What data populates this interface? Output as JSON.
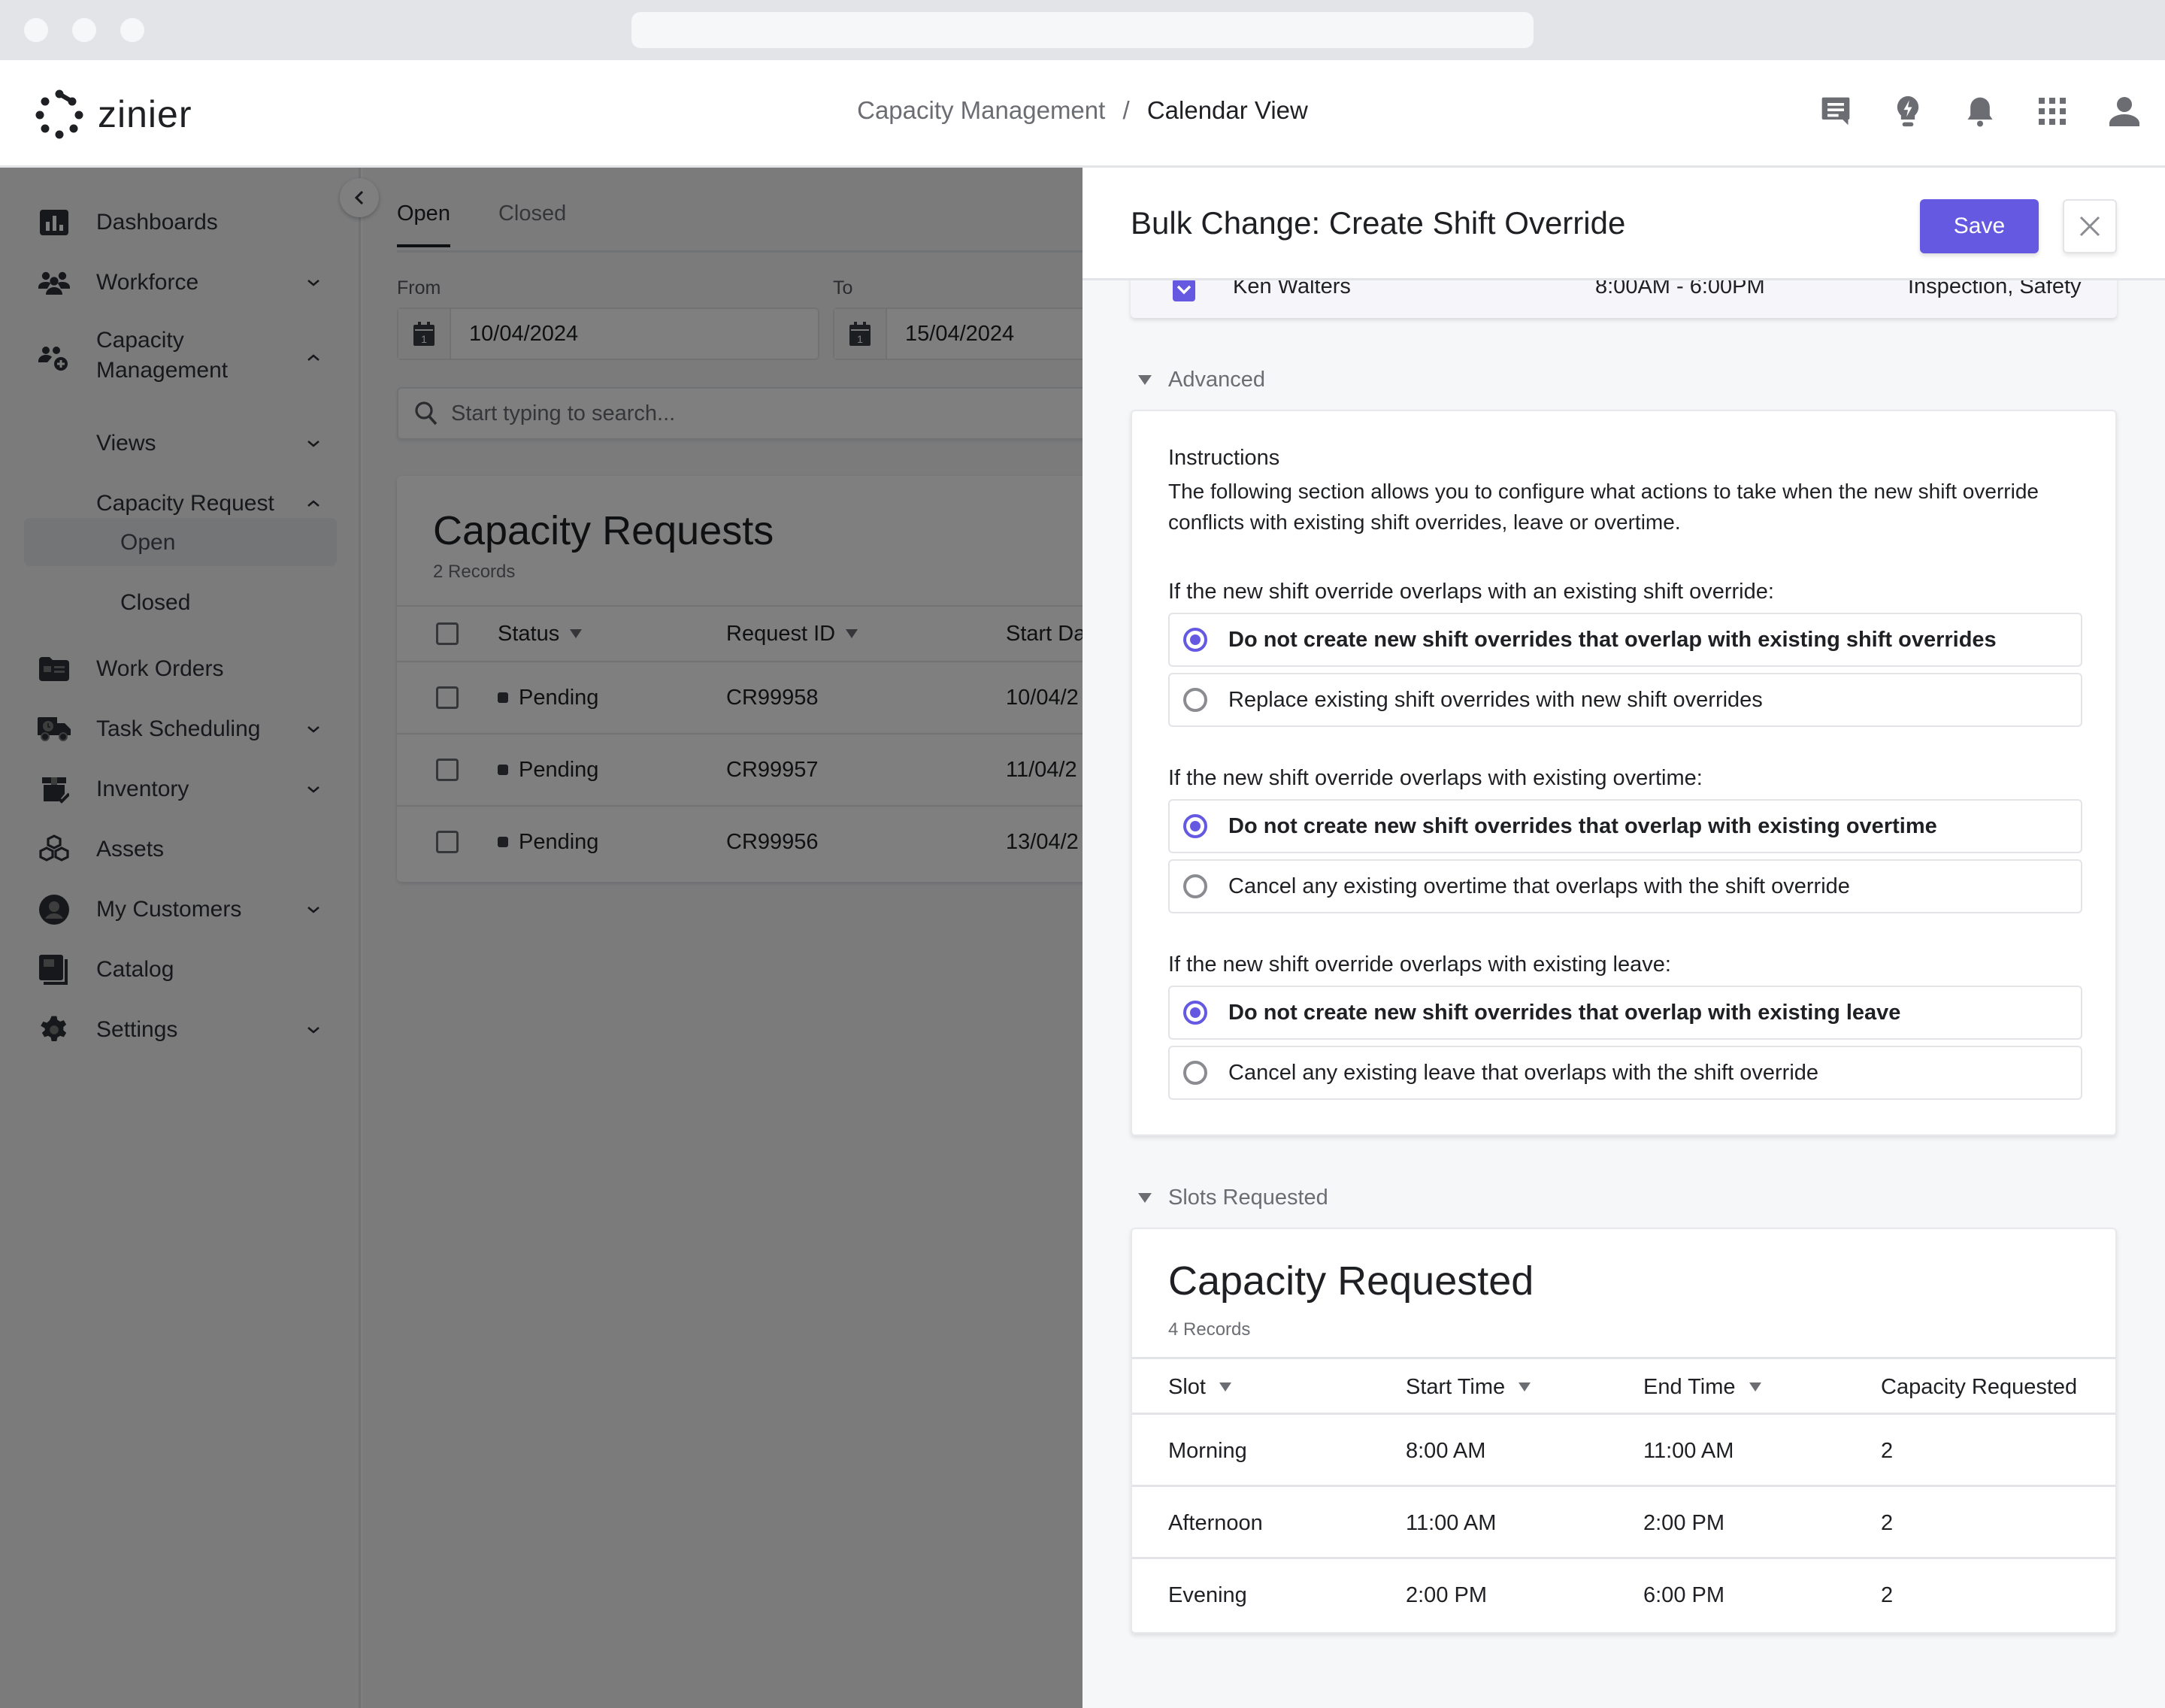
{
  "header": {
    "logo_text": "zinier",
    "breadcrumb": {
      "parent": "Capacity Management",
      "separator": "/",
      "current": "Calendar View"
    },
    "icons": [
      "chat-icon",
      "lightbulb-icon",
      "bell-icon",
      "apps-grid-icon",
      "user-icon"
    ]
  },
  "sidebar": {
    "items": [
      {
        "label": "Dashboards",
        "icon": "dashboard-icon",
        "chevron": null
      },
      {
        "label": "Workforce",
        "icon": "workforce-icon",
        "chevron": "down"
      },
      {
        "label": "Capacity\nManagement",
        "icon": "capacity-management-icon",
        "chevron": "up"
      },
      {
        "label": "Views",
        "icon": null,
        "chevron": "down"
      },
      {
        "label": "Capacity Request",
        "icon": null,
        "chevron": "up"
      },
      {
        "label": "Open",
        "icon": null,
        "chevron": null,
        "selected": true
      },
      {
        "label": "Closed",
        "icon": null,
        "chevron": null
      },
      {
        "label": "Work Orders",
        "icon": "work-orders-icon",
        "chevron": null
      },
      {
        "label": "Task Scheduling",
        "icon": "truck-clock-icon",
        "chevron": "down"
      },
      {
        "label": "Inventory",
        "icon": "inventory-icon",
        "chevron": "down"
      },
      {
        "label": "Assets",
        "icon": "assets-icon",
        "chevron": null
      },
      {
        "label": "My Customers",
        "icon": "customer-icon",
        "chevron": "down"
      },
      {
        "label": "Catalog",
        "icon": "catalog-icon",
        "chevron": null
      },
      {
        "label": "Settings",
        "icon": "gear-icon",
        "chevron": "down"
      }
    ]
  },
  "main": {
    "tabs": [
      {
        "label": "Open",
        "active": true
      },
      {
        "label": "Closed",
        "active": false
      }
    ],
    "from_label": "From",
    "from_value": "10/04/2024",
    "to_label": "To",
    "to_value": "15/04/2024",
    "search_placeholder": "Start typing to search...",
    "table": {
      "title": "Capacity Requests",
      "record_count": "2 Records",
      "columns": [
        "Status",
        "Request ID",
        "Start Da"
      ],
      "rows": [
        {
          "status": "Pending",
          "request_id": "CR99958",
          "start_date": "10/04/2"
        },
        {
          "status": "Pending",
          "request_id": "CR99957",
          "start_date": "11/04/2"
        },
        {
          "status": "Pending",
          "request_id": "CR99956",
          "start_date": "13/04/2"
        }
      ]
    }
  },
  "drawer": {
    "title": "Bulk Change: Create Shift Override",
    "save_label": "Save",
    "employee_row": {
      "name": "Ken Walters",
      "shift": "8:00AM - 6:00PM",
      "skills": "Inspection, Safety",
      "checked": true
    },
    "advanced": {
      "toggle_label": "Advanced",
      "instructions_heading": "Instructions",
      "instructions_text": "The following section allows you to configure what actions to take when the new shift override conflicts with existing shift overrides, leave or overtime.",
      "groups": [
        {
          "question": "If the new shift override overlaps with an existing shift override:",
          "options": [
            {
              "label": "Do not create new shift overrides that overlap with existing shift overrides",
              "selected": true
            },
            {
              "label": "Replace existing shift overrides with new shift overrides",
              "selected": false
            }
          ]
        },
        {
          "question": "If the new shift override overlaps with existing overtime:",
          "options": [
            {
              "label": "Do not create new shift overrides that overlap with existing overtime",
              "selected": true
            },
            {
              "label": "Cancel any existing overtime that overlaps with the shift override",
              "selected": false
            }
          ]
        },
        {
          "question": "If the new shift override overlaps with existing leave:",
          "options": [
            {
              "label": "Do not create new shift overrides that overlap with existing leave",
              "selected": true
            },
            {
              "label": "Cancel any existing leave that overlaps with the shift override",
              "selected": false
            }
          ]
        }
      ]
    },
    "slots": {
      "toggle_label": "Slots Requested",
      "title": "Capacity Requested",
      "record_count": "4 Records",
      "columns": [
        "Slot",
        "Start Time",
        "End Time",
        "Capacity Requested"
      ],
      "rows": [
        {
          "slot": "Morning",
          "start": "8:00 AM",
          "end": "11:00 AM",
          "capacity": "2"
        },
        {
          "slot": "Afternoon",
          "start": "11:00 AM",
          "end": "2:00 PM",
          "capacity": "2"
        },
        {
          "slot": "Evening",
          "start": "2:00 PM",
          "end": "6:00 PM",
          "capacity": "2"
        }
      ]
    }
  },
  "colors": {
    "accent": "#6559e2",
    "text_primary": "#1f2024",
    "text_secondary": "#6b6d73",
    "border": "#e3e4e8",
    "overlay": "rgba(0,0,0,0.5)"
  }
}
